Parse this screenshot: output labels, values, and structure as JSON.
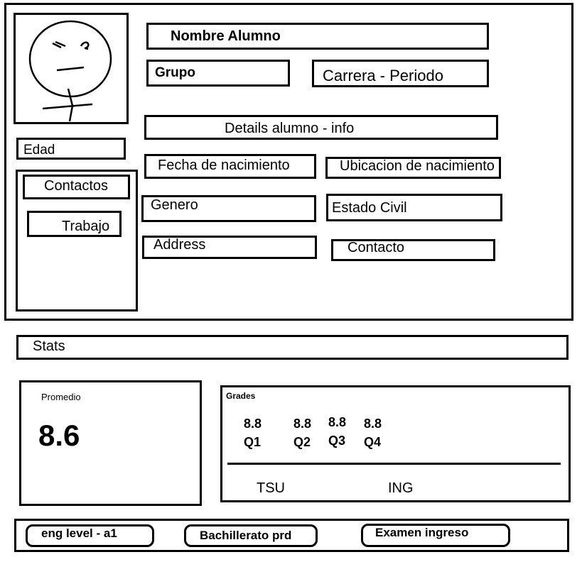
{
  "profile": {
    "name": "Nombre Alumno",
    "grupo": "Grupo",
    "carrera_periodo": "Carrera - Periodo",
    "details_header": "Details alumno - info",
    "edad": "Edad",
    "fecha_nacimiento": "Fecha de nacimiento",
    "ubicacion_nacimiento": "Ubicacion de nacimiento",
    "genero": "Genero",
    "estado_civil": "Estado Civil",
    "address": "Address",
    "contacto": "Contacto"
  },
  "contacts_panel": {
    "contactos": "Contactos",
    "trabajo": "Trabajo"
  },
  "stats": {
    "header": "Stats",
    "promedio_label": "Promedio",
    "promedio_value": "8.6",
    "grades_label": "Grades",
    "quarters": [
      {
        "value": "8.8",
        "label": "Q1"
      },
      {
        "value": "8.8",
        "label": "Q2"
      },
      {
        "value": "8.8",
        "label": "Q3"
      },
      {
        "value": "8.8",
        "label": "Q4"
      }
    ],
    "tsu": "TSU",
    "ing": "ING"
  },
  "footer": {
    "eng_level": "eng level - a1",
    "bachillerato": "Bachillerato prd",
    "examen": "Examen ingreso"
  }
}
